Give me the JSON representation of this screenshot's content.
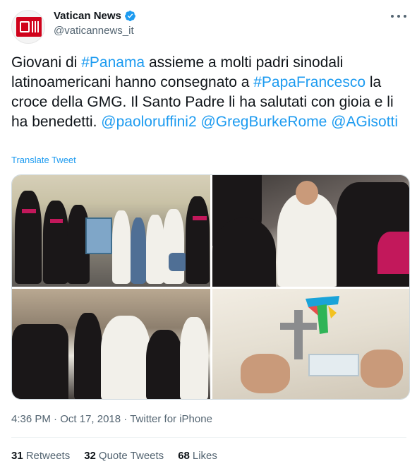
{
  "author": {
    "display_name": "Vatican News",
    "handle": "@vaticannews_it",
    "verified": true,
    "avatar_icon": "vatican-news-logo"
  },
  "tweet": {
    "segments": [
      {
        "text": "Giovani di ",
        "type": "text"
      },
      {
        "text": "#Panama",
        "type": "tag"
      },
      {
        "text": " assieme a molti padri sinodali latinoamericani hanno consegnato a ",
        "type": "text"
      },
      {
        "text": "#PapaFrancesco",
        "type": "tag"
      },
      {
        "text": " la croce della GMG. Il Santo Padre li ha salutati con gioia e li ha benedetti. ",
        "type": "text"
      },
      {
        "text": "@paoloruffini2",
        "type": "tag"
      },
      {
        "text": " ",
        "type": "text"
      },
      {
        "text": "@GregBurkeRome",
        "type": "tag"
      },
      {
        "text": " ",
        "type": "text"
      },
      {
        "text": "@AGisotti",
        "type": "tag"
      }
    ],
    "translate_label": "Translate Tweet"
  },
  "media": {
    "photo_count": 4
  },
  "meta": {
    "time": "4:36 PM",
    "date": "Oct 17, 2018",
    "source": "Twitter for iPhone"
  },
  "stats": {
    "retweets_count": "31",
    "retweets_label": "Retweets",
    "quote_count": "32",
    "quote_label": "Quote Tweets",
    "likes_count": "68",
    "likes_label": "Likes"
  },
  "colors": {
    "accent": "#1d9bf0",
    "text": "#0f1419",
    "muted": "#536471",
    "brand_red": "#d0021b"
  }
}
